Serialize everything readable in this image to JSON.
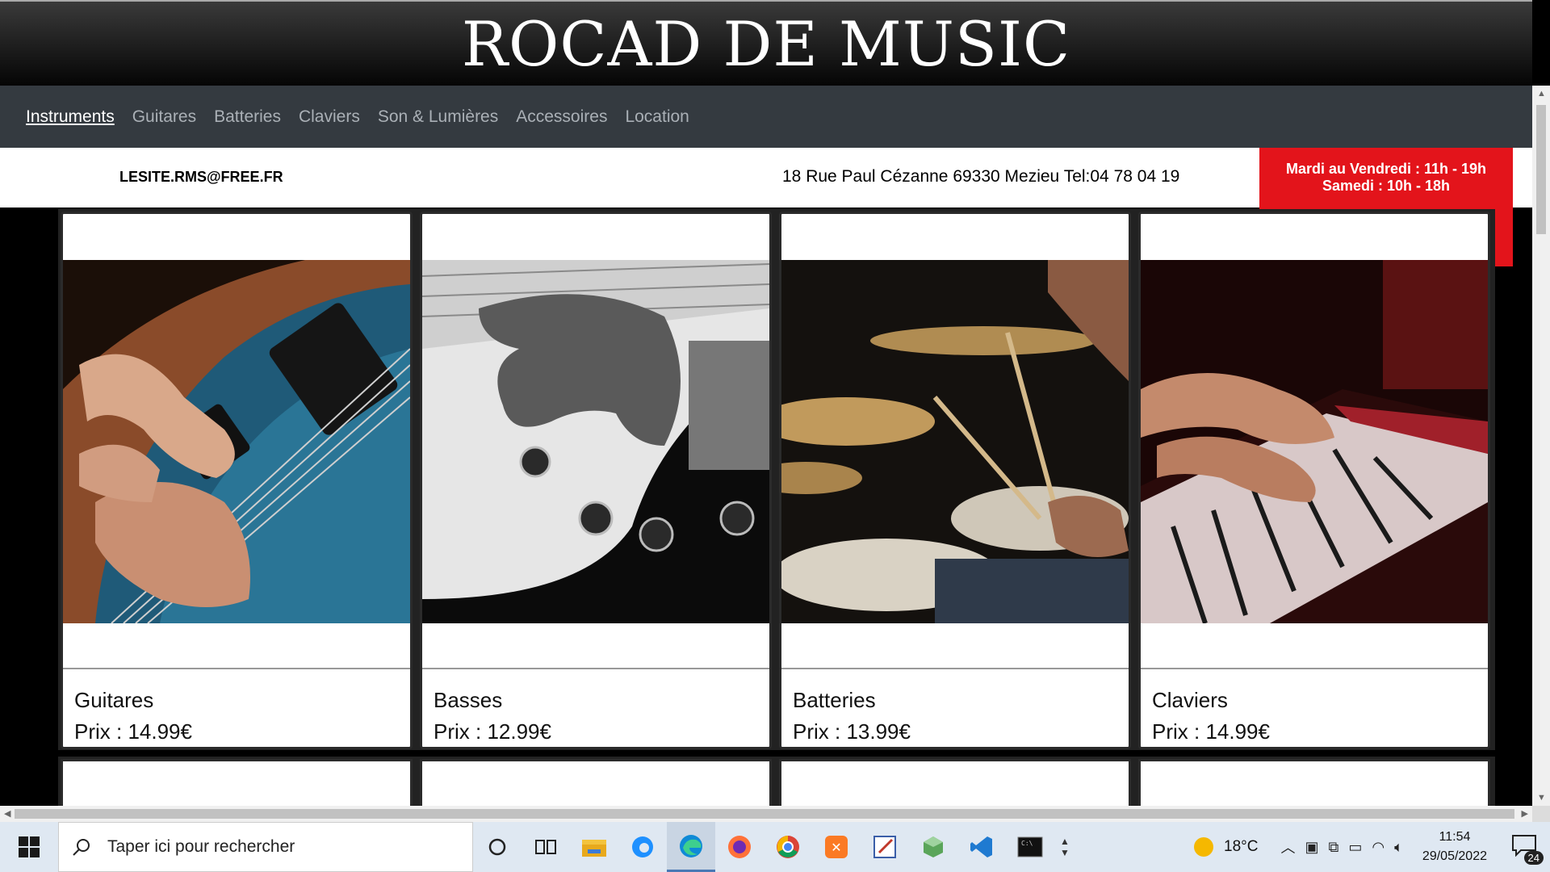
{
  "site": {
    "title": "ROCAD DE MUSIC"
  },
  "nav": {
    "items": [
      {
        "label": "Instruments",
        "active": true
      },
      {
        "label": "Guitares",
        "active": false
      },
      {
        "label": "Batteries",
        "active": false
      },
      {
        "label": "Claviers",
        "active": false
      },
      {
        "label": "Son & Lumières",
        "active": false
      },
      {
        "label": "Accessoires",
        "active": false
      },
      {
        "label": "Location",
        "active": false
      }
    ]
  },
  "info": {
    "email": "LESITE.RMS@FREE.FR",
    "address": "18 Rue Paul Cézanne 69330 Mezieu Tel:04 78 04 19",
    "hours_line1": "Mardi au Vendredi : 11h - 19h",
    "hours_line2": "Samedi : 10h - 18h",
    "hours_color": "#e3141b"
  },
  "products": [
    {
      "name": "Guitares",
      "price": "Prix : 14.99€",
      "image": "electric-guitar-photo"
    },
    {
      "name": "Basses",
      "price": "Prix : 12.99€",
      "image": "bass-guitar-photo"
    },
    {
      "name": "Batteries",
      "price": "Prix : 13.99€",
      "image": "drums-photo"
    },
    {
      "name": "Claviers",
      "price": "Prix : 14.99€",
      "image": "keyboard-photo"
    }
  ],
  "taskbar": {
    "search_placeholder": "Taper ici pour rechercher",
    "apps": [
      "cortana-icon",
      "task-view-icon",
      "file-explorer-icon",
      "edge-legacy-icon",
      "edge-icon",
      "firefox-icon",
      "chrome-icon",
      "xampp-icon",
      "editor-icon",
      "cube-app-icon",
      "vscode-icon",
      "terminal-icon"
    ],
    "temperature": "18°C",
    "time": "11:54",
    "date": "29/05/2022",
    "notifications": "24"
  }
}
